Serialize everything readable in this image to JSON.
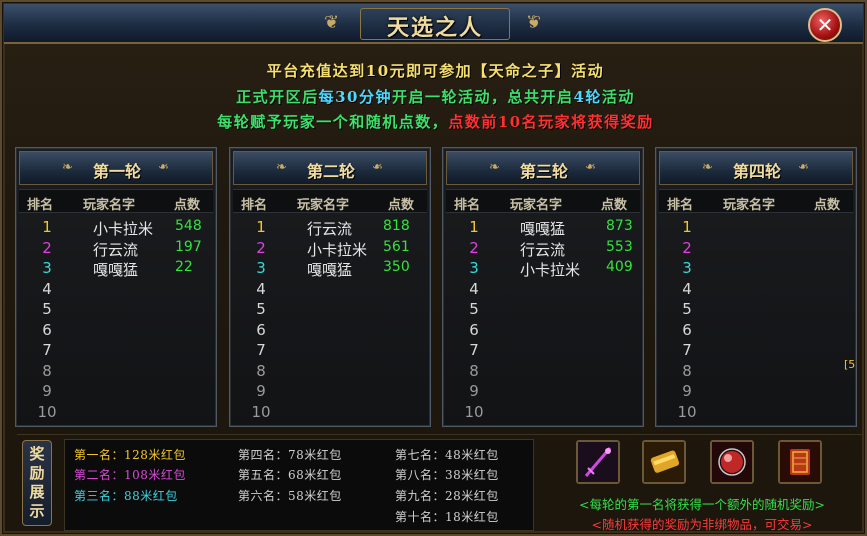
{
  "window": {
    "title": "天选之人"
  },
  "notice": {
    "line1": "平台充值达到10元即可参加【天命之子】活动",
    "line2_a": "正式开区后",
    "line2_b": "每30分钟",
    "line2_c": "开启一轮活动，总共开启",
    "line2_d": "4轮",
    "line2_e": "活动",
    "line3_a": "每轮赋予玩家一个和随机点数，",
    "line3_b": "点数前10名玩家将获得奖励"
  },
  "column_headers": {
    "rank": "排名",
    "name": "玩家名字",
    "score": "点数"
  },
  "rounds": [
    {
      "title": "第一轮",
      "entries": [
        {
          "rank": "1",
          "name": "小卡拉米",
          "score": "548"
        },
        {
          "rank": "2",
          "name": "行云流",
          "score": "197"
        },
        {
          "rank": "3",
          "name": "嘎嘎猛",
          "score": "22"
        },
        {
          "rank": "4",
          "name": "",
          "score": ""
        },
        {
          "rank": "5",
          "name": "",
          "score": ""
        },
        {
          "rank": "6",
          "name": "",
          "score": ""
        },
        {
          "rank": "7",
          "name": "",
          "score": ""
        },
        {
          "rank": "8",
          "name": "",
          "score": ""
        },
        {
          "rank": "9",
          "name": "",
          "score": ""
        },
        {
          "rank": "10",
          "name": "",
          "score": ""
        }
      ]
    },
    {
      "title": "第二轮",
      "entries": [
        {
          "rank": "1",
          "name": "行云流",
          "score": "818"
        },
        {
          "rank": "2",
          "name": "小卡拉米",
          "score": "561"
        },
        {
          "rank": "3",
          "name": "嘎嘎猛",
          "score": "350"
        },
        {
          "rank": "4",
          "name": "",
          "score": ""
        },
        {
          "rank": "5",
          "name": "",
          "score": ""
        },
        {
          "rank": "6",
          "name": "",
          "score": ""
        },
        {
          "rank": "7",
          "name": "",
          "score": ""
        },
        {
          "rank": "8",
          "name": "",
          "score": ""
        },
        {
          "rank": "9",
          "name": "",
          "score": ""
        },
        {
          "rank": "10",
          "name": "",
          "score": ""
        }
      ]
    },
    {
      "title": "第三轮",
      "entries": [
        {
          "rank": "1",
          "name": "嘎嘎猛",
          "score": "873"
        },
        {
          "rank": "2",
          "name": "行云流",
          "score": "553"
        },
        {
          "rank": "3",
          "name": "小卡拉米",
          "score": "409"
        },
        {
          "rank": "4",
          "name": "",
          "score": ""
        },
        {
          "rank": "5",
          "name": "",
          "score": ""
        },
        {
          "rank": "6",
          "name": "",
          "score": ""
        },
        {
          "rank": "7",
          "name": "",
          "score": ""
        },
        {
          "rank": "8",
          "name": "",
          "score": ""
        },
        {
          "rank": "9",
          "name": "",
          "score": ""
        },
        {
          "rank": "10",
          "name": "",
          "score": ""
        }
      ]
    },
    {
      "title": "第四轮",
      "entries": [
        {
          "rank": "1",
          "name": "",
          "score": ""
        },
        {
          "rank": "2",
          "name": "",
          "score": ""
        },
        {
          "rank": "3",
          "name": "",
          "score": ""
        },
        {
          "rank": "4",
          "name": "",
          "score": ""
        },
        {
          "rank": "5",
          "name": "",
          "score": ""
        },
        {
          "rank": "6",
          "name": "",
          "score": ""
        },
        {
          "rank": "7",
          "name": "",
          "score": ""
        },
        {
          "rank": "8",
          "name": "",
          "score": ""
        },
        {
          "rank": "9",
          "name": "",
          "score": ""
        },
        {
          "rank": "10",
          "name": "",
          "score": ""
        }
      ]
    }
  ],
  "rewards": {
    "label_chars": [
      "奖",
      "励",
      "展",
      "示"
    ],
    "prizes": [
      "第一名：128米红包",
      "第二名：108米红包",
      "第三名：88米红包",
      "第四名：78米红包",
      "第五名：68米红包",
      "第六名：58米红包",
      "第七名：48米红包",
      "第八名：38米红包",
      "第九名：28米红包",
      "第十名：18米红包"
    ],
    "items": [
      "sword-item-icon",
      "scroll-item-icon",
      "orb-item-icon",
      "book-item-icon"
    ],
    "bonus_note": "<每轮的第一名将获得一个额外的随机奖励>",
    "trade_note": "<随机获得的奖励为非绑物品，可交易>"
  },
  "edge_mark": "[5",
  "colors": {
    "gold": "#f4c52a",
    "purple": "#d84ad8",
    "cyan": "#3cd4e0",
    "green": "#34e23c",
    "red": "#ff3030"
  }
}
